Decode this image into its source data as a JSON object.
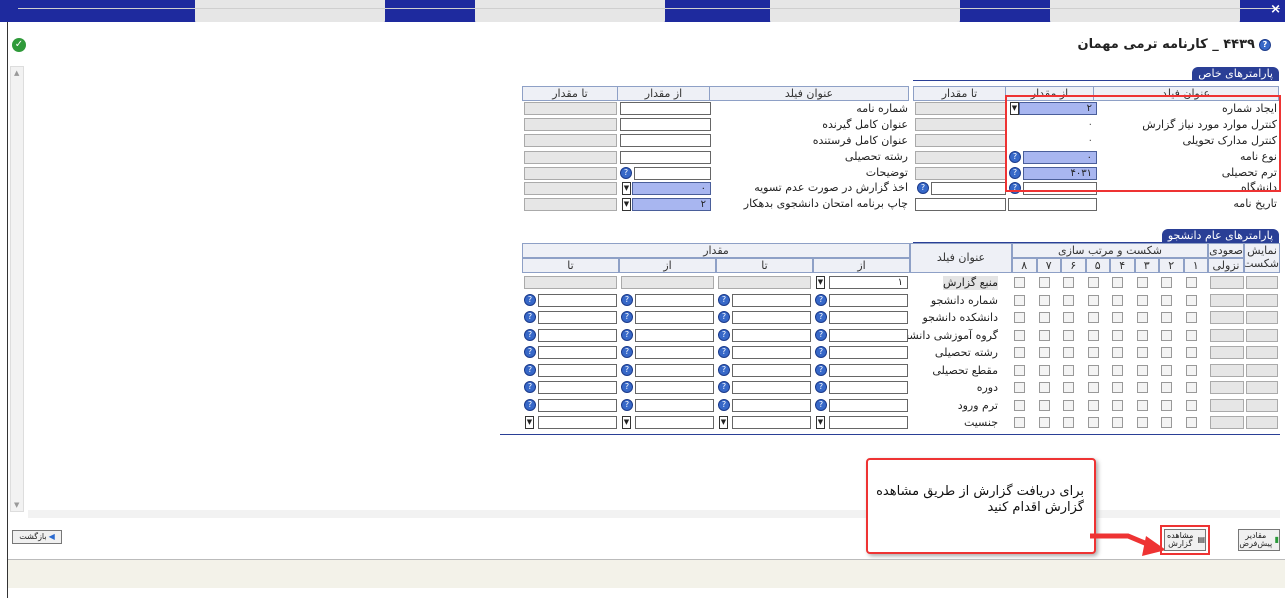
{
  "window": {
    "close_glyph": "×"
  },
  "form": {
    "title": "۴۴۳۹ _ کارنامه ترمی مهمان"
  },
  "special_params": {
    "tab_label": "پارامترهای خاص",
    "right_headers": {
      "field_title": "عنوان فیلد",
      "from_value": "از مقدار",
      "to_value": "تا مقدار"
    },
    "left_headers": {
      "field_title": "عنوان فیلد",
      "from_value": "از مقدار",
      "to_value": "تا مقدار"
    },
    "right_rows": [
      {
        "label": "ایجاد شماره",
        "value": "۲"
      },
      {
        "label": "کنترل موارد مورد نیاز گزارش",
        "value": "۰"
      },
      {
        "label": "کنترل مدارک تحویلی",
        "value": "۰"
      },
      {
        "label": "نوع نامه",
        "value": "۰"
      },
      {
        "label": "ترم تحصیلی",
        "value": "۴۰۳۱"
      },
      {
        "label": "دانشگاه",
        "value": ""
      },
      {
        "label": "تاریخ نامه",
        "value": ""
      }
    ],
    "left_rows": [
      {
        "label": "شماره نامه",
        "value": ""
      },
      {
        "label": "عنوان کامل گیرنده",
        "value": ""
      },
      {
        "label": "عنوان کامل فرستنده",
        "value": ""
      },
      {
        "label": "رشته تحصیلی",
        "value": ""
      },
      {
        "label": "توضیحات",
        "value": ""
      },
      {
        "label": "اخذ گزارش در صورت عدم تسویه",
        "value": "۰"
      },
      {
        "label": "چاپ برنامه امتحان دانشجوی بدهکار",
        "value": "۲"
      }
    ]
  },
  "student_params": {
    "tab_label": "پارامترهای عام دانشجو",
    "headers": {
      "show_break": "نمایش شکست",
      "ascending": "صعودی",
      "descending": "نزولی",
      "sort_break": "شکست و مرتب سازی",
      "field_title": "عنوان فیلد",
      "value": "مقدار",
      "from": "از",
      "to": "تا",
      "sort_nums": [
        "۱",
        "۲",
        "۳",
        "۴",
        "۵",
        "۶",
        "۷",
        "۸"
      ]
    },
    "rows": [
      {
        "label": "منبع گزارش",
        "from1": "۱"
      },
      {
        "label": "شماره دانشجو",
        "from1": ""
      },
      {
        "label": "دانشکده دانشجو",
        "from1": ""
      },
      {
        "label": "گروه آموزشی دانشجو",
        "from1": ""
      },
      {
        "label": "رشته تحصیلی",
        "from1": ""
      },
      {
        "label": "مقطع تحصیلی",
        "from1": ""
      },
      {
        "label": "دوره",
        "from1": ""
      },
      {
        "label": "ترم ورود",
        "from1": ""
      },
      {
        "label": "جنسیت",
        "from1": ""
      }
    ]
  },
  "callout": {
    "text": "برای دریافت گزارش از طریق مشاهده گزارش اقدام کنید"
  },
  "buttons": {
    "back": "بازگشت",
    "view_report": "مشاهده گزارش",
    "defaults": "مقادیر پیش‌فرض"
  },
  "colors": {
    "accent": "#2a3f96",
    "highlight": "#ee3333",
    "selected_field": "#a8b6f0"
  }
}
